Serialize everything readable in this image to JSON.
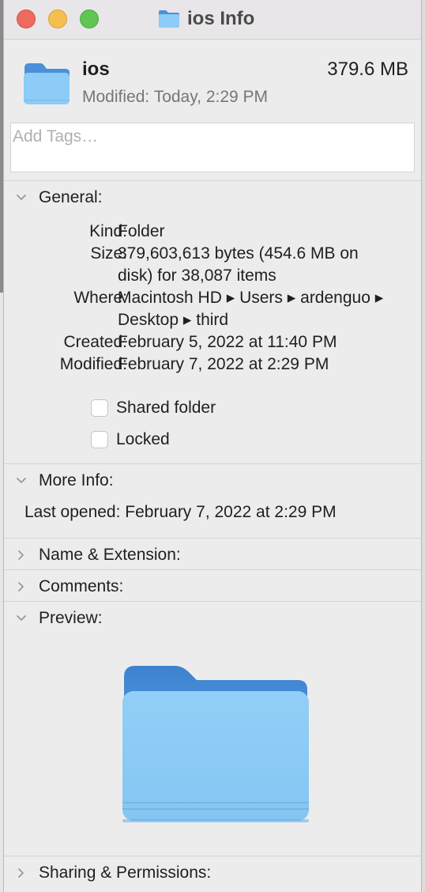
{
  "window": {
    "title": "ios Info",
    "icon": "folder-icon"
  },
  "traffic_lights": [
    "close",
    "minimize",
    "zoom"
  ],
  "header": {
    "name": "ios",
    "size": "379.6 MB",
    "modified_label": "Modified:",
    "modified_value": "Today, 2:29 PM"
  },
  "tags": {
    "placeholder": "Add Tags…",
    "value": ""
  },
  "general": {
    "heading": "General:",
    "expanded": true,
    "rows": [
      {
        "label": "Kind:",
        "value": "Folder"
      },
      {
        "label": "Size:",
        "value": "379,603,613 bytes (454.6 MB on disk) for 38,087 items"
      },
      {
        "label": "Where:",
        "value": "Macintosh HD ▸ Users ▸ ardenguo ▸ Desktop ▸ third"
      },
      {
        "label": "Created:",
        "value": "February 5, 2022 at 11:40 PM"
      },
      {
        "label": "Modified:",
        "value": "February 7, 2022 at 2:29 PM"
      }
    ],
    "checkboxes": [
      {
        "label": "Shared folder",
        "checked": false
      },
      {
        "label": "Locked",
        "checked": false
      }
    ]
  },
  "more_info": {
    "heading": "More Info:",
    "expanded": true,
    "last_opened_label": "Last opened:",
    "last_opened_value": "February 7, 2022 at 2:29 PM"
  },
  "name_extension": {
    "heading": "Name & Extension:",
    "expanded": false
  },
  "comments": {
    "heading": "Comments:",
    "expanded": false
  },
  "preview": {
    "heading": "Preview:",
    "expanded": true,
    "icon": "folder-icon"
  },
  "sharing": {
    "heading": "Sharing & Permissions:",
    "expanded": false
  },
  "colors": {
    "folder_light": "#8cccf6",
    "folder_dark": "#4a90d9",
    "close": "#ed6a5e",
    "minimize": "#f5bf4f",
    "zoom": "#61c554"
  }
}
